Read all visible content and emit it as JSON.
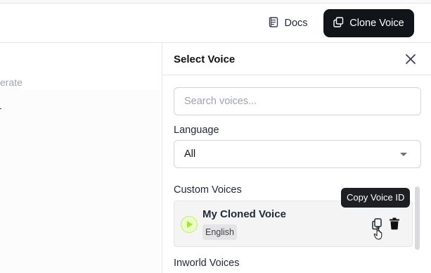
{
  "header": {
    "docs_label": "Docs",
    "clone_label": "Clone Voice"
  },
  "left": {
    "partial_label": "erate"
  },
  "panel": {
    "title": "Select Voice",
    "search_placeholder": "Search voices...",
    "language_label": "Language",
    "language_value": "All",
    "custom_section": "Custom Voices",
    "inworld_section": "Inworld Voices",
    "voices": [
      {
        "name": "My Cloned Voice",
        "language": "English"
      }
    ],
    "tooltip": "Copy Voice ID"
  },
  "colors": {
    "primary_button": "#111418",
    "play_accent": "#a3e635",
    "tooltip_bg": "#1e1f24"
  },
  "icons": [
    "document-icon",
    "copy-icon",
    "close-icon",
    "chevron-down-icon",
    "play-icon",
    "trash-icon",
    "pointer-cursor-icon"
  ]
}
